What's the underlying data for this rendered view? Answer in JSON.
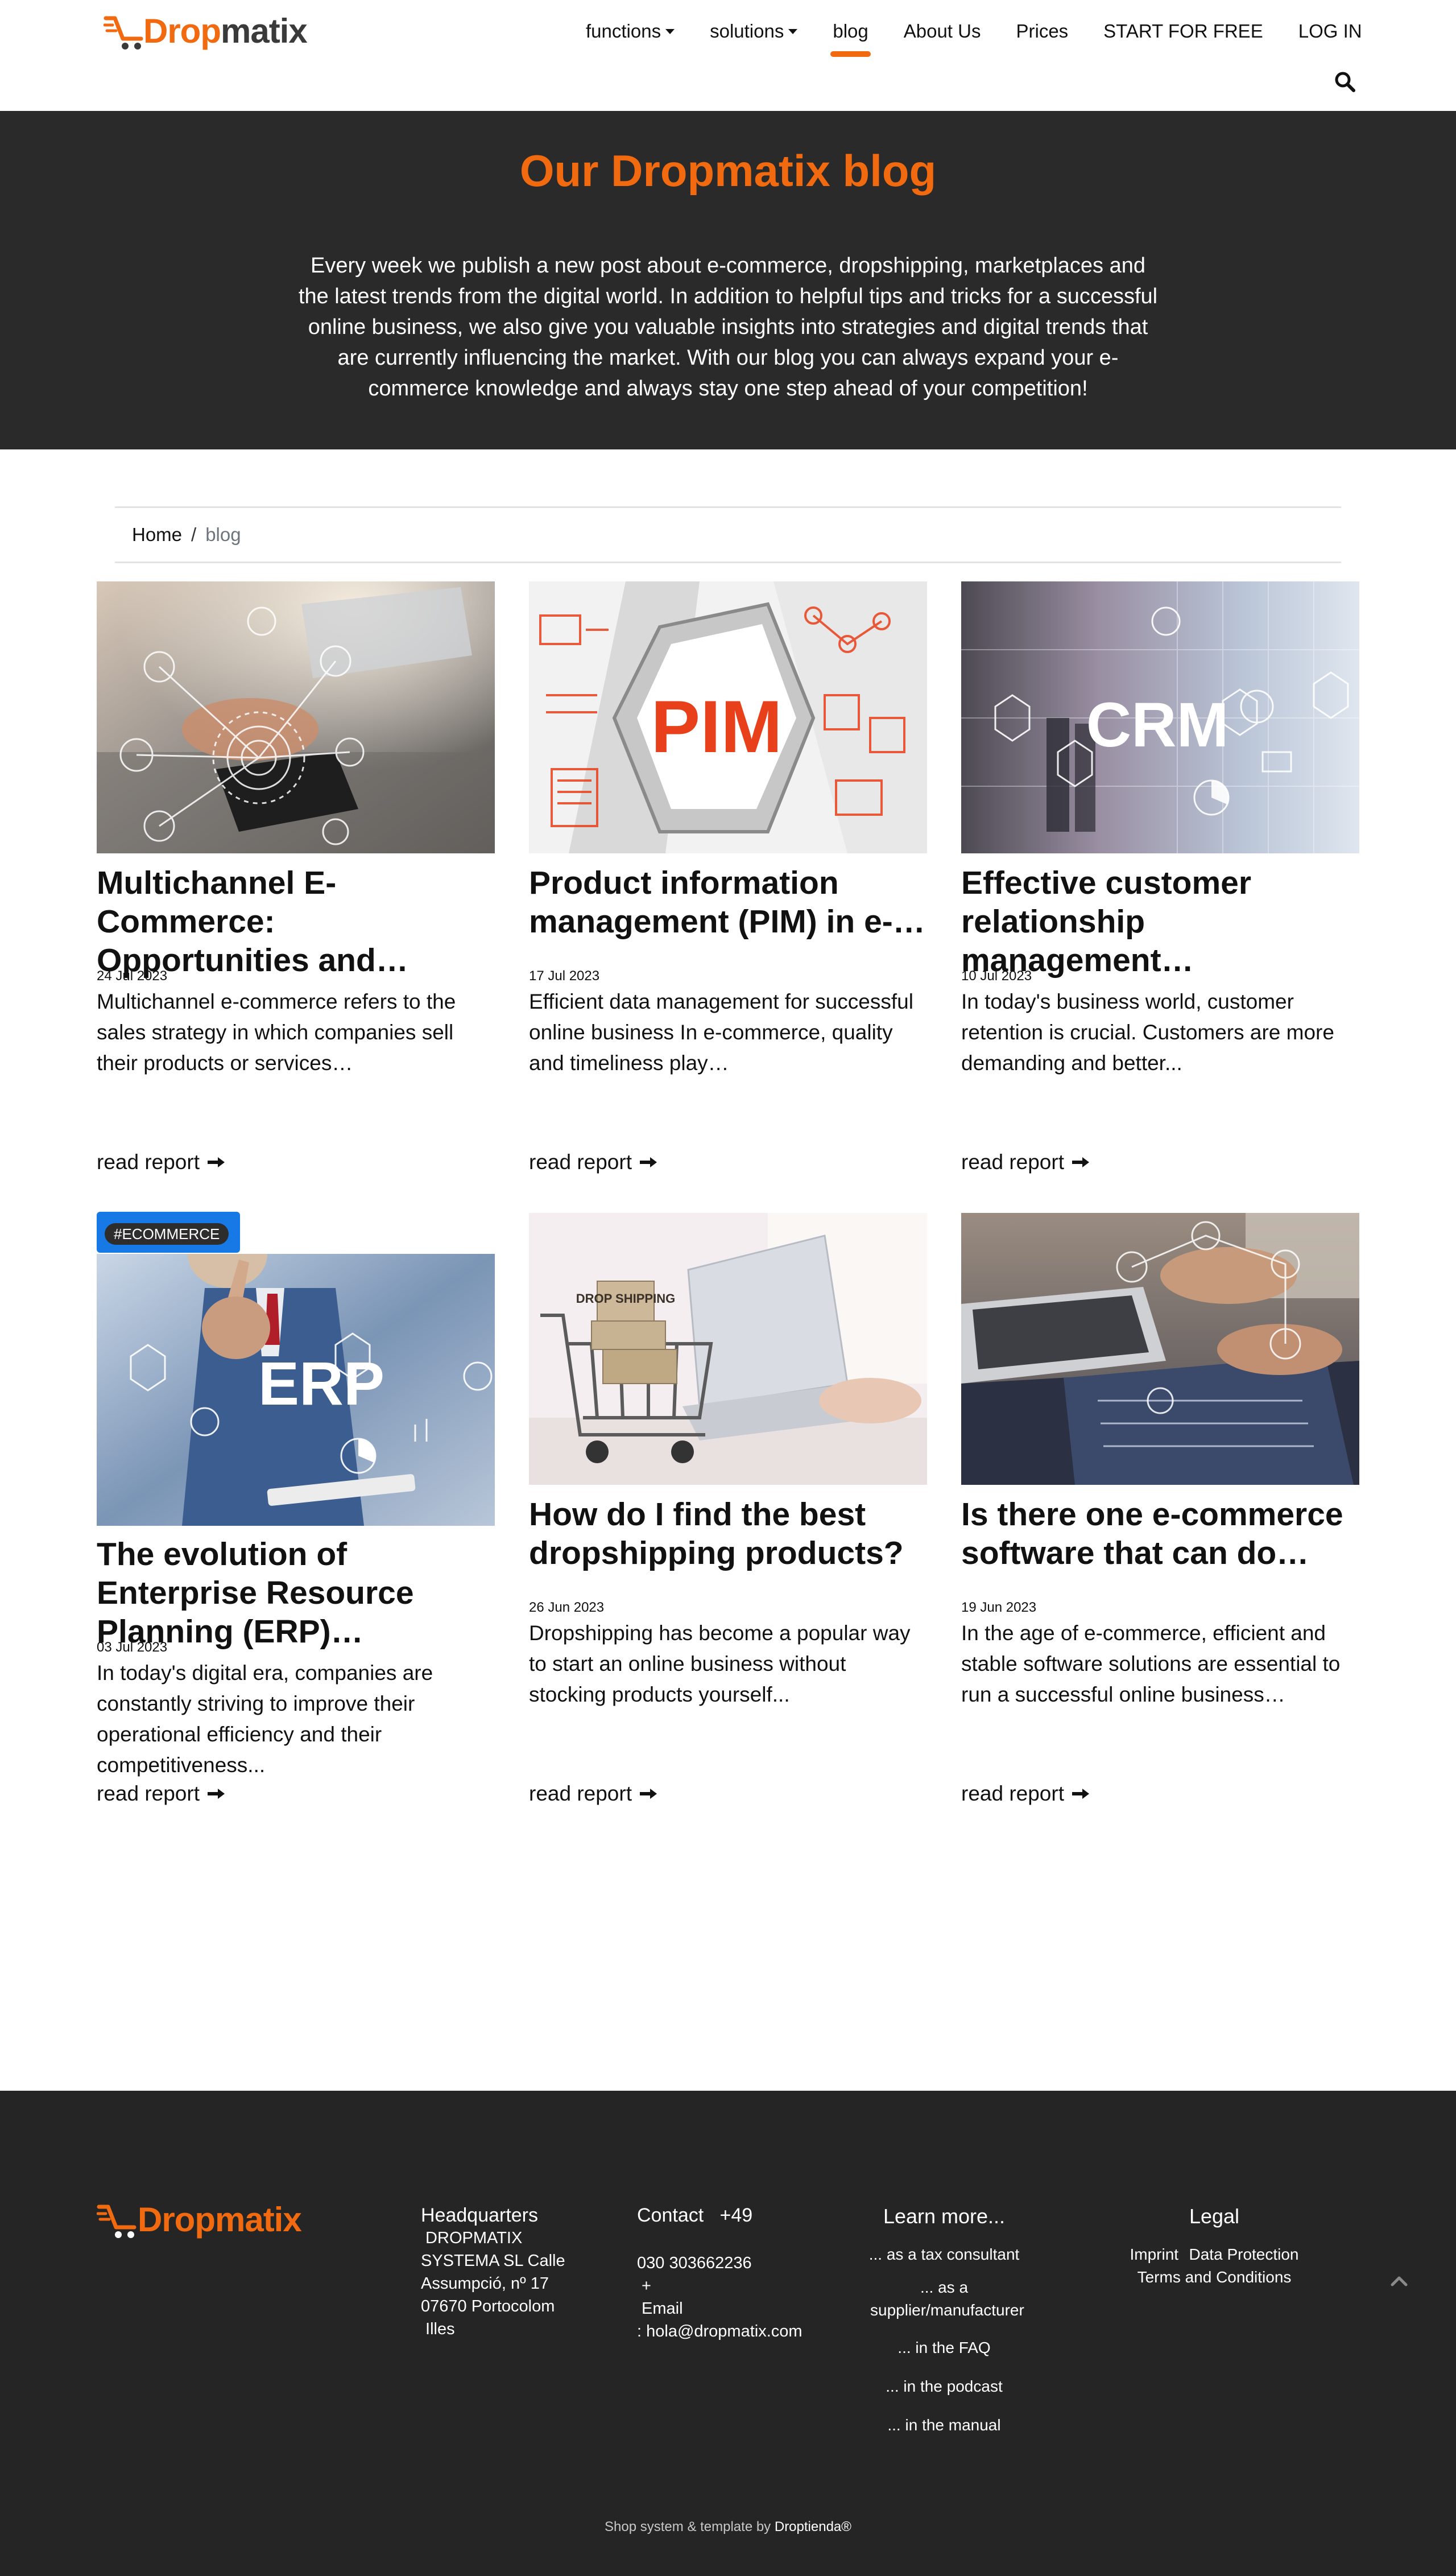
{
  "brand": {
    "logo_text_accent": "Drop",
    "logo_text_rest": "matix",
    "accent_color": "#f26a10"
  },
  "nav": {
    "items": [
      {
        "label": "functions",
        "dropdown": true
      },
      {
        "label": "solutions",
        "dropdown": true
      },
      {
        "label": "blog",
        "active": true
      },
      {
        "label": "About Us"
      },
      {
        "label": "Prices"
      },
      {
        "label": "START FOR FREE"
      },
      {
        "label": "LOG IN"
      }
    ]
  },
  "hero": {
    "title": "Our Dropmatix blog",
    "text": "Every week we publish a new post about e-commerce, dropshipping, marketplaces and the latest trends from the digital world. In addition to helpful tips and tricks for a successful online business, we also give you valuable insights into strategies and digital trends that are currently influencing the market. With our blog you can always expand your e-commerce knowledge and always stay one step ahead of your competition!"
  },
  "breadcrumb": {
    "home": "Home",
    "separator": "/",
    "current": "blog"
  },
  "posts": [
    {
      "title": "Multichannel E-Commerce: Opportunities and…",
      "date": "24 Jul 2023",
      "excerpt": "Multichannel e-commerce refers to the sales strategy in which companies sell their products or services…",
      "read": "read report",
      "image": "multichannel"
    },
    {
      "title": "Product information management (PIM) in e-…",
      "date": "17 Jul 2023",
      "excerpt": "Efficient data management for successful online business In e-commerce, quality and timeliness play…",
      "read": "read report",
      "image": "pim",
      "image_text": "PIM"
    },
    {
      "title": "Effective customer relationship management…",
      "date": "10 Jul 2023",
      "excerpt": "In today's business world, customer retention is crucial. Customers are more demanding and better...",
      "read": "read report",
      "image": "crm",
      "image_text": "CRM"
    },
    {
      "title": "The evolution of Enterprise Resource Planning (ERP)…",
      "date": "03 Jul 2023",
      "excerpt": "In today's digital era, companies are constantly striving to improve their operational efficiency and their competitiveness...",
      "read": "read report",
      "image": "erp",
      "image_text": "ERP",
      "tag": "#ECOMMERCE"
    },
    {
      "title": "How do I find the best dropshipping products?",
      "date": "26 Jun 2023",
      "excerpt": "Dropshipping has become a popular way to start an online business without stocking products yourself...",
      "read": "read report",
      "image": "dropshipping",
      "image_text": "DROP SHIPPING"
    },
    {
      "title": "Is there one e-commerce software that can do…",
      "date": "19 Jun 2023",
      "excerpt": "In the age of e-commerce, efficient and stable software solutions are essential to run a successful online business…",
      "read": "read report",
      "image": "software"
    }
  ],
  "footer": {
    "headquarters": {
      "heading": "Headquarters",
      "lines": [
        " DROPMATIX",
        "SYSTEMA SL Calle",
        "Assumpció, nº 17",
        "07670 Portocolom",
        " Illes"
      ]
    },
    "contact": {
      "heading": "Contact   +49",
      "lines": [
        "030 303662236",
        " +",
        " Email",
        ": hola@dropmatix.com"
      ]
    },
    "learn": {
      "heading": "Learn more...",
      "links": [
        "... as a tax consultant",
        "... as a supplier/manufacturer",
        "... in the FAQ",
        "... in the podcast",
        "... in the manual"
      ]
    },
    "legal": {
      "heading": "Legal",
      "links": [
        "Imprint",
        "Data Protection",
        "Terms and Conditions"
      ]
    },
    "bottom_prefix": "Shop system & template by ",
    "bottom_brand": "Droptienda®"
  }
}
